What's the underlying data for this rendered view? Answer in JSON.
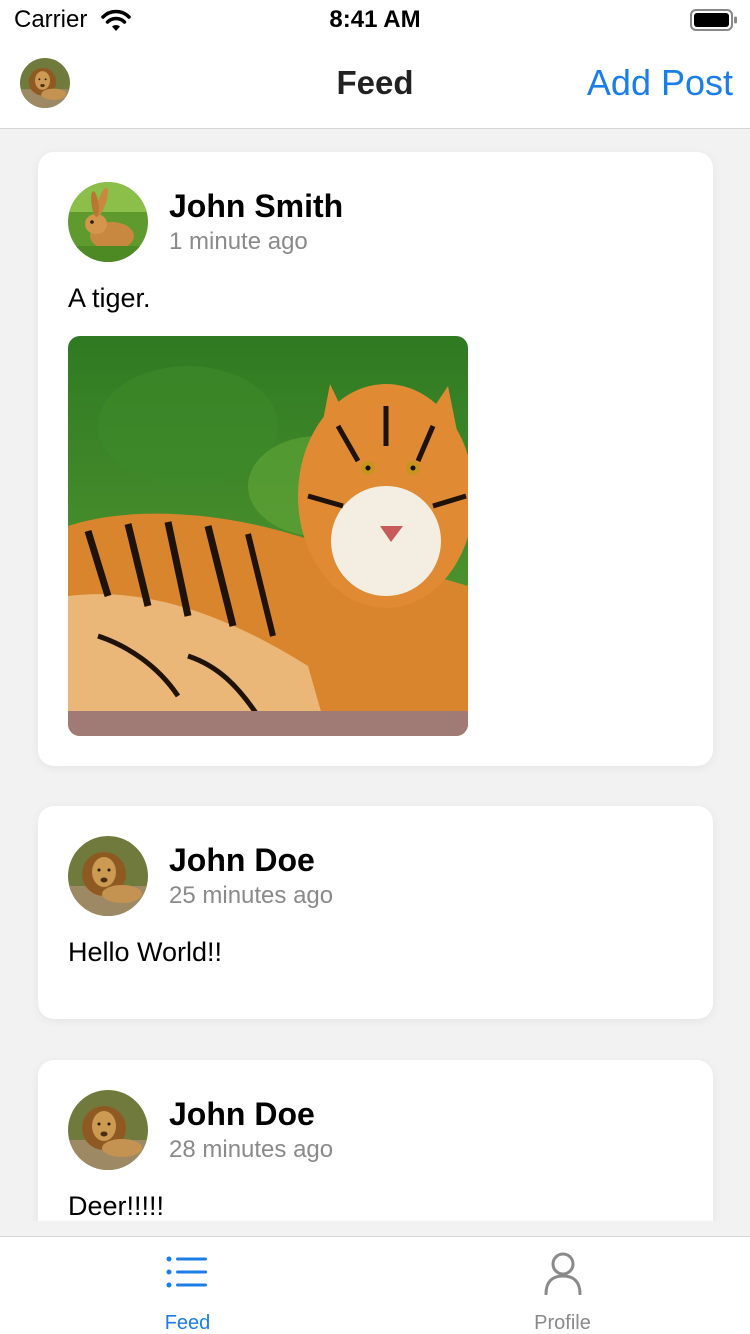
{
  "status_bar": {
    "carrier": "Carrier",
    "time": "8:41 AM"
  },
  "nav": {
    "title": "Feed",
    "add_post_label": "Add Post",
    "avatar_icon": "lion-avatar"
  },
  "posts": [
    {
      "author": "John Smith",
      "time": "1 minute ago",
      "text": "A tiger.",
      "avatar_icon": "rabbit-avatar",
      "image_icon": "tiger-photo"
    },
    {
      "author": "John Doe",
      "time": "25 minutes ago",
      "text": "Hello World!!",
      "avatar_icon": "lion-avatar"
    },
    {
      "author": "John Doe",
      "time": "28 minutes ago",
      "text": "Deer!!!!!",
      "avatar_icon": "lion-avatar"
    }
  ],
  "tabs": [
    {
      "label": "Feed",
      "icon": "list-icon",
      "active": true
    },
    {
      "label": "Profile",
      "icon": "person-icon",
      "active": false
    }
  ],
  "colors": {
    "accent": "#1a7ee8",
    "inactive": "#8a8a8a",
    "background": "#f2f2f2",
    "card": "#ffffff"
  }
}
